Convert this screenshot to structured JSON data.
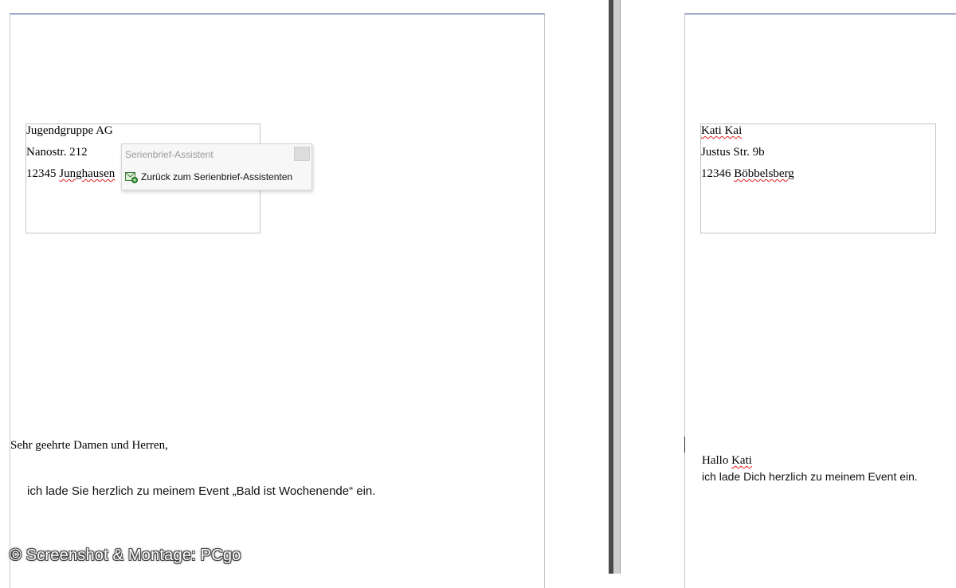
{
  "left_document": {
    "address": {
      "line1": "Jugendgruppe AG",
      "line2": "Nanostr. 212",
      "line3_zip": "12345",
      "line3_city": "Junghausen"
    },
    "salutation": "Sehr geehrte Damen und Herren,",
    "body": "ich lade Sie herzlich zu meinem Event „Bald ist Wochenende“ ein."
  },
  "popup": {
    "title": "Serienbrief-Assistent",
    "item_label": "Zurück zum Serienbrief-Assistenten",
    "icon": "mail-merge-wizard-icon"
  },
  "right_document": {
    "address": {
      "line1": "Kati Kai",
      "line2": "Justus Str. 9b",
      "line3_zip": "12346",
      "line3_city": "Böbbelsberg"
    },
    "salutation_prefix": "Hallo",
    "salutation_name": "Kati",
    "body": "ich lade Dich herzlich zu meinem Event ein."
  },
  "watermark": "© Screenshot & Montage: PCgo",
  "colors": {
    "page_top_border": "#2f3f8f",
    "spellcheck": "#e02020",
    "divider": "#4a4a4a"
  }
}
